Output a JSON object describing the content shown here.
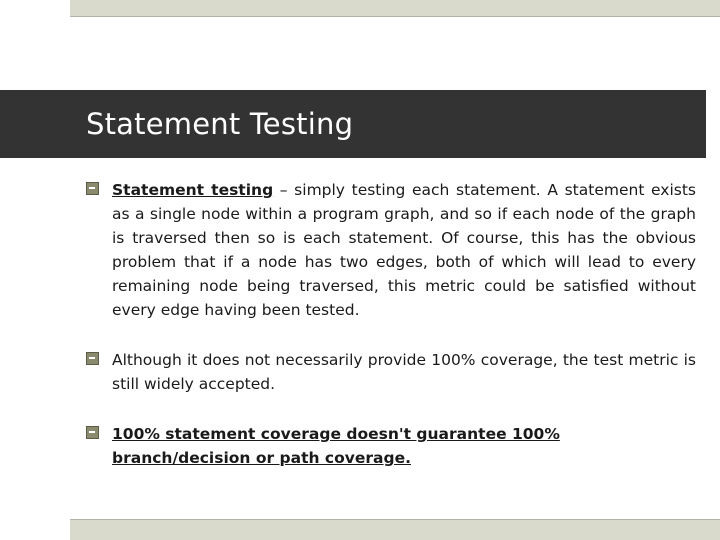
{
  "slide": {
    "title": "Statement Testing",
    "theme": {
      "title_bar_color": "#333333",
      "band_color": "#d9d9cc",
      "band_rule_color": "#b3b3a6",
      "bullet_marker_color": "#8a8a6e",
      "text_color": "#1a1a1a",
      "title_text_color": "#ffffff"
    },
    "bullets": [
      {
        "marker": "square-bullet-icon",
        "lead_underlined": "Statement  testing",
        "rest": " – simply testing each statement. A statement exists as a single node within a program graph, and so if each node of the graph is traversed then so is each statement. Of course, this has the obvious problem that if a node has two edges, both of which will lead to every remaining node being traversed, this metric could be satisfied without every edge having been tested."
      },
      {
        "marker": "square-bullet-icon",
        "text": "Although it does not necessarily provide 100% coverage, the test metric is still widely accepted."
      },
      {
        "marker": "square-bullet-icon",
        "line1_underlined": "100%  statement  coverage   doesn't  guarantee  100%",
        "line2_underlined": "branch/decision or path coverage."
      }
    ]
  }
}
